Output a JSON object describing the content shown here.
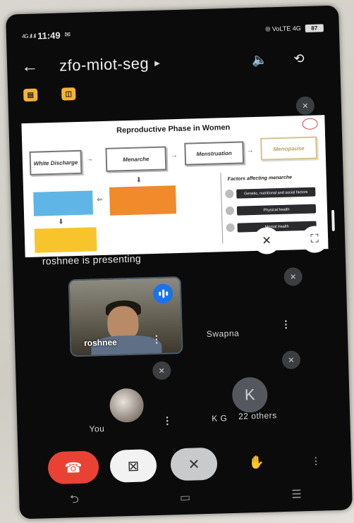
{
  "status_bar": {
    "signal": "4G .ıll .ıll",
    "time": "11:49",
    "right_icons": "⦾ VoLTE 4G",
    "battery": "87"
  },
  "header": {
    "meeting_code": "zfo-miot-seg",
    "back_icon": "back-arrow-icon",
    "speaker_icon": "speaker-icon",
    "switch_camera_icon": "switch-camera-icon"
  },
  "slide": {
    "title": "Reproductive Phase in Women",
    "boxes": {
      "white_discharge": "White Discharge",
      "menarche": "Menarche",
      "menstruation": "Menstruation",
      "menopause": "Menopause"
    },
    "factors_title": "Factors affecting menarche",
    "factors": [
      "Genetic, nutritional and social factors",
      "Physical health",
      "Mental Health"
    ]
  },
  "presenting_text": "roshnee is presenting",
  "participants": [
    {
      "name": "roshnee",
      "video": true,
      "speaking": true
    },
    {
      "name": "Swapna",
      "muted": true
    },
    {
      "name": "You",
      "muted": true
    },
    {
      "name": "K G",
      "extra": "22 others",
      "avatar_letter": "K"
    }
  ],
  "controls": [
    "end-call",
    "camera-off",
    "mic-off",
    "raise-hand",
    "more"
  ],
  "colors": {
    "end_call": "#e94235",
    "speaking": "#1a73e8",
    "badge": "#f4b431"
  }
}
